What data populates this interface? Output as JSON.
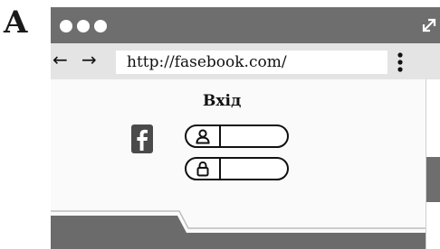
{
  "panel_label": "A",
  "window": {
    "titlebar_dots": 3,
    "navigation": {
      "back_arrow": "←",
      "forward_arrow": "→",
      "url": "http://fasebook.com/",
      "menu_icon": "kebab-vertical-icon"
    }
  },
  "page": {
    "title": "Вхід",
    "logo_icon": "facebook-f-icon",
    "fields": [
      {
        "icon": "user-icon",
        "value": ""
      },
      {
        "icon": "lock-icon",
        "value": ""
      }
    ]
  },
  "colors": {
    "titlebar": "#6e6e6e",
    "navbar": "#e4e4e4",
    "content": "#fafafa",
    "footer": "#6b6b6b",
    "logo": "#4a4a4a"
  }
}
